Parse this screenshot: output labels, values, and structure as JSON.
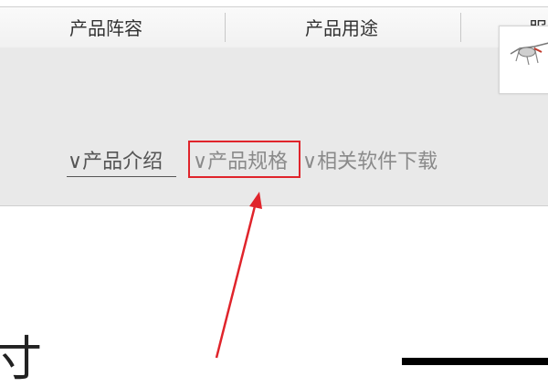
{
  "nav": {
    "items": [
      {
        "label": "产品阵容"
      },
      {
        "label": "产品用途"
      },
      {
        "label": "服"
      }
    ]
  },
  "tabs": {
    "items": [
      {
        "label": "∨产品介绍"
      },
      {
        "label": "∨产品规格"
      },
      {
        "label": "∨相关软件下载"
      }
    ]
  },
  "thumbnail": {
    "icon": "product-sketch-icon"
  },
  "annotation": {
    "box_color": "#e0242b",
    "arrow_color": "#e0242b"
  },
  "partial_heading": {
    "text": "寸"
  }
}
